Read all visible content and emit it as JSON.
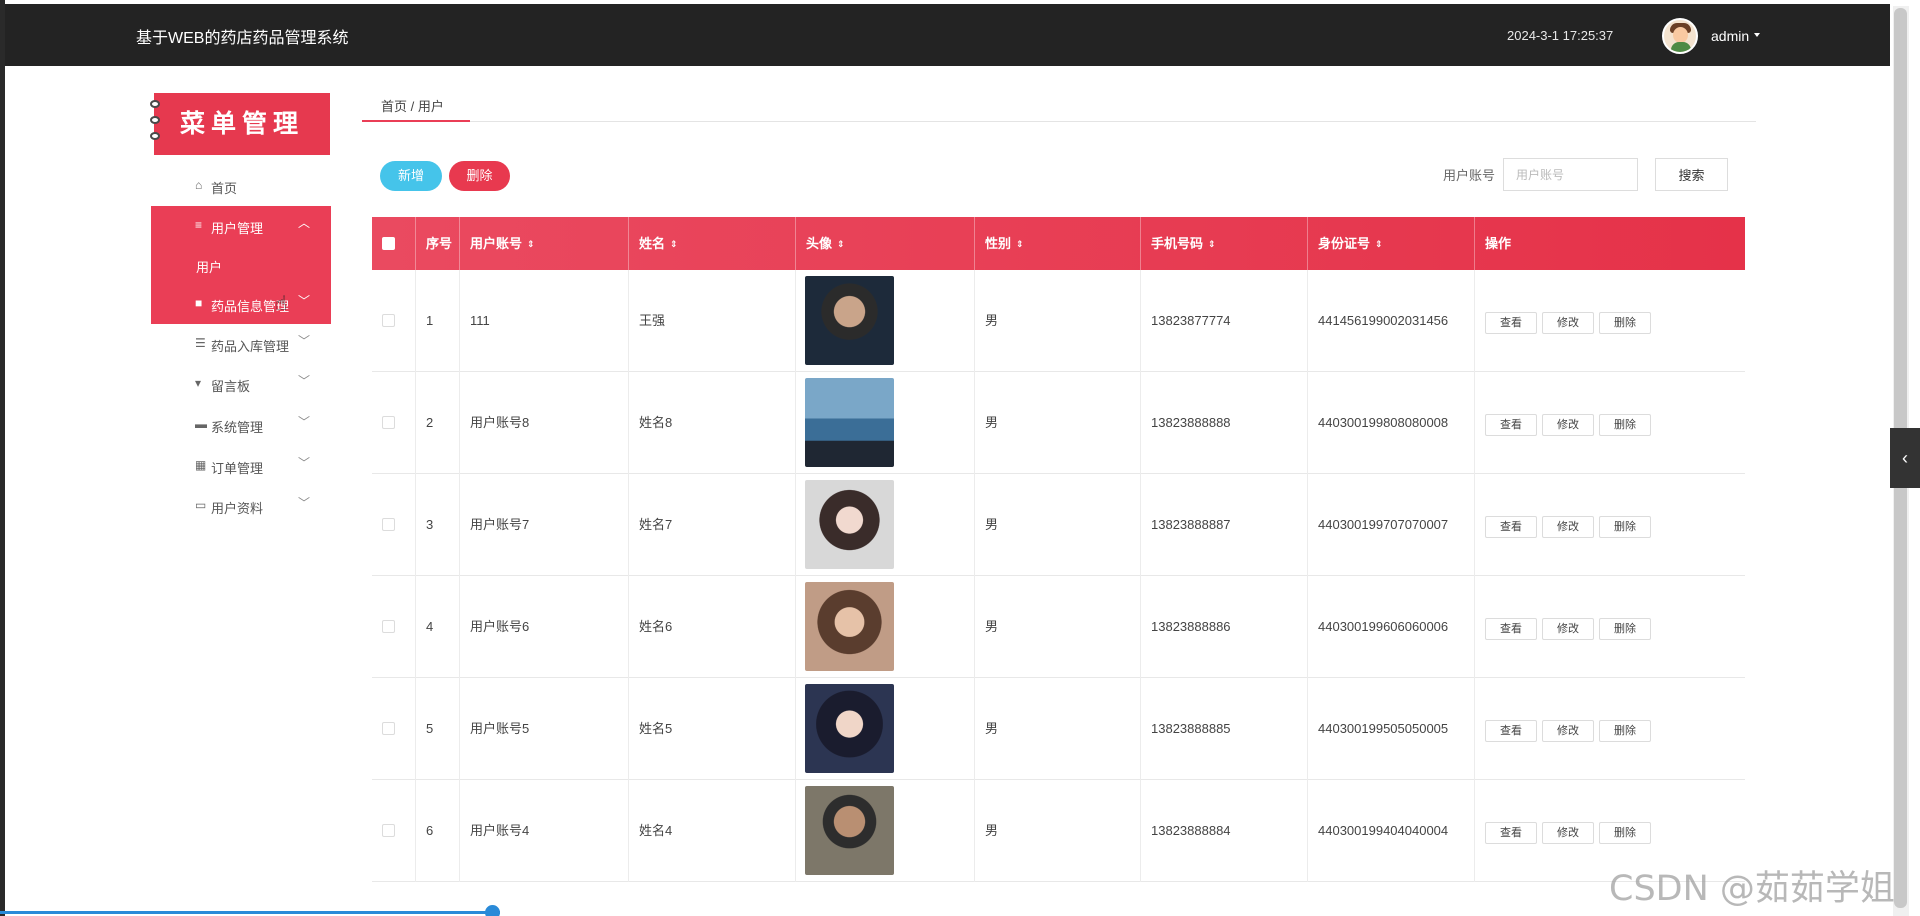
{
  "app": {
    "title": "基于WEB的药店药品管理系统",
    "datetime": "2024-3-1 17:25:37",
    "user": "admin"
  },
  "menu_banner": "菜单管理",
  "sidebar": {
    "items": [
      {
        "label": "首页",
        "icon": "home-icon"
      },
      {
        "label": "用户管理",
        "icon": "list-icon"
      },
      {
        "label": "用户",
        "icon": ""
      },
      {
        "label": "药品信息管理",
        "icon": "bag-icon"
      },
      {
        "label": "药品入库管理",
        "icon": "sliders-icon"
      },
      {
        "label": "留言板",
        "icon": "pin-icon"
      },
      {
        "label": "系统管理",
        "icon": "chat-icon"
      },
      {
        "label": "订单管理",
        "icon": "grid-icon"
      },
      {
        "label": "用户资料",
        "icon": "card-icon"
      }
    ]
  },
  "breadcrumb": "首页 / 用户",
  "toolbar": {
    "add_label": "新增",
    "delete_label": "删除",
    "search_label": "用户账号",
    "search_placeholder": "用户账号",
    "search_button": "搜索"
  },
  "table": {
    "columns": [
      "序号",
      "用户账号",
      "姓名",
      "头像",
      "性别",
      "手机号码",
      "身份证号",
      "操作"
    ],
    "rows": [
      {
        "index": "1",
        "account": "111",
        "name": "王强",
        "gender": "男",
        "phone": "13823877774",
        "id_card": "441456199002031456"
      },
      {
        "index": "2",
        "account": "用户账号8",
        "name": "姓名8",
        "gender": "男",
        "phone": "13823888888",
        "id_card": "440300199808080008"
      },
      {
        "index": "3",
        "account": "用户账号7",
        "name": "姓名7",
        "gender": "男",
        "phone": "13823888887",
        "id_card": "440300199707070007"
      },
      {
        "index": "4",
        "account": "用户账号6",
        "name": "姓名6",
        "gender": "男",
        "phone": "13823888886",
        "id_card": "440300199606060006"
      },
      {
        "index": "5",
        "account": "用户账号5",
        "name": "姓名5",
        "gender": "男",
        "phone": "13823888885",
        "id_card": "440300199505050005"
      },
      {
        "index": "6",
        "account": "用户账号4",
        "name": "姓名4",
        "gender": "男",
        "phone": "13823888884",
        "id_card": "440300199404040004"
      }
    ],
    "actions": [
      "查看",
      "修改",
      "删除"
    ]
  },
  "watermark": "CSDN @茹茹学姐",
  "colors": {
    "accent": "#ea3e56",
    "topbar": "#232323",
    "add_button": "#45c4ea"
  }
}
